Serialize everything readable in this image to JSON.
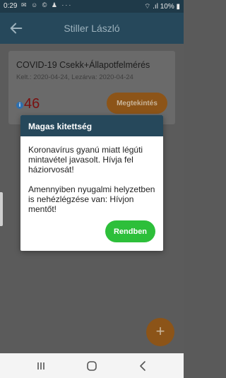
{
  "status_bar": {
    "time": "0:29",
    "icons": "✉ ☺ © ♟ ···",
    "right": "⌔ .ıl 10% ▮"
  },
  "app_bar": {
    "title": "Stiller László",
    "back_icon": "arrow-left-icon"
  },
  "card": {
    "title": "COVID-19 Csekk+Állapotfelmérés",
    "dates": "Kelt.: 2020-04-24, Lezárva: 2020-04-24",
    "info_icon": "i",
    "score": "46",
    "view_label": "Megtekintés"
  },
  "dialog": {
    "title": "Magas kitettség",
    "paragraph1": "Koronavírus gyanú miatt légúti mintavétel javasolt. Hívja fel háziorvosát!",
    "paragraph2": "Amennyiben nyugalmi helyzetben is nehézlégzése van: Hívjon mentőt!",
    "ok_label": "Rendben"
  },
  "fab": {
    "label": "+"
  },
  "colors": {
    "primary": "#26485b",
    "accent": "#e8902e",
    "confirm": "#2dbf3a",
    "score_red": "#c62828"
  }
}
